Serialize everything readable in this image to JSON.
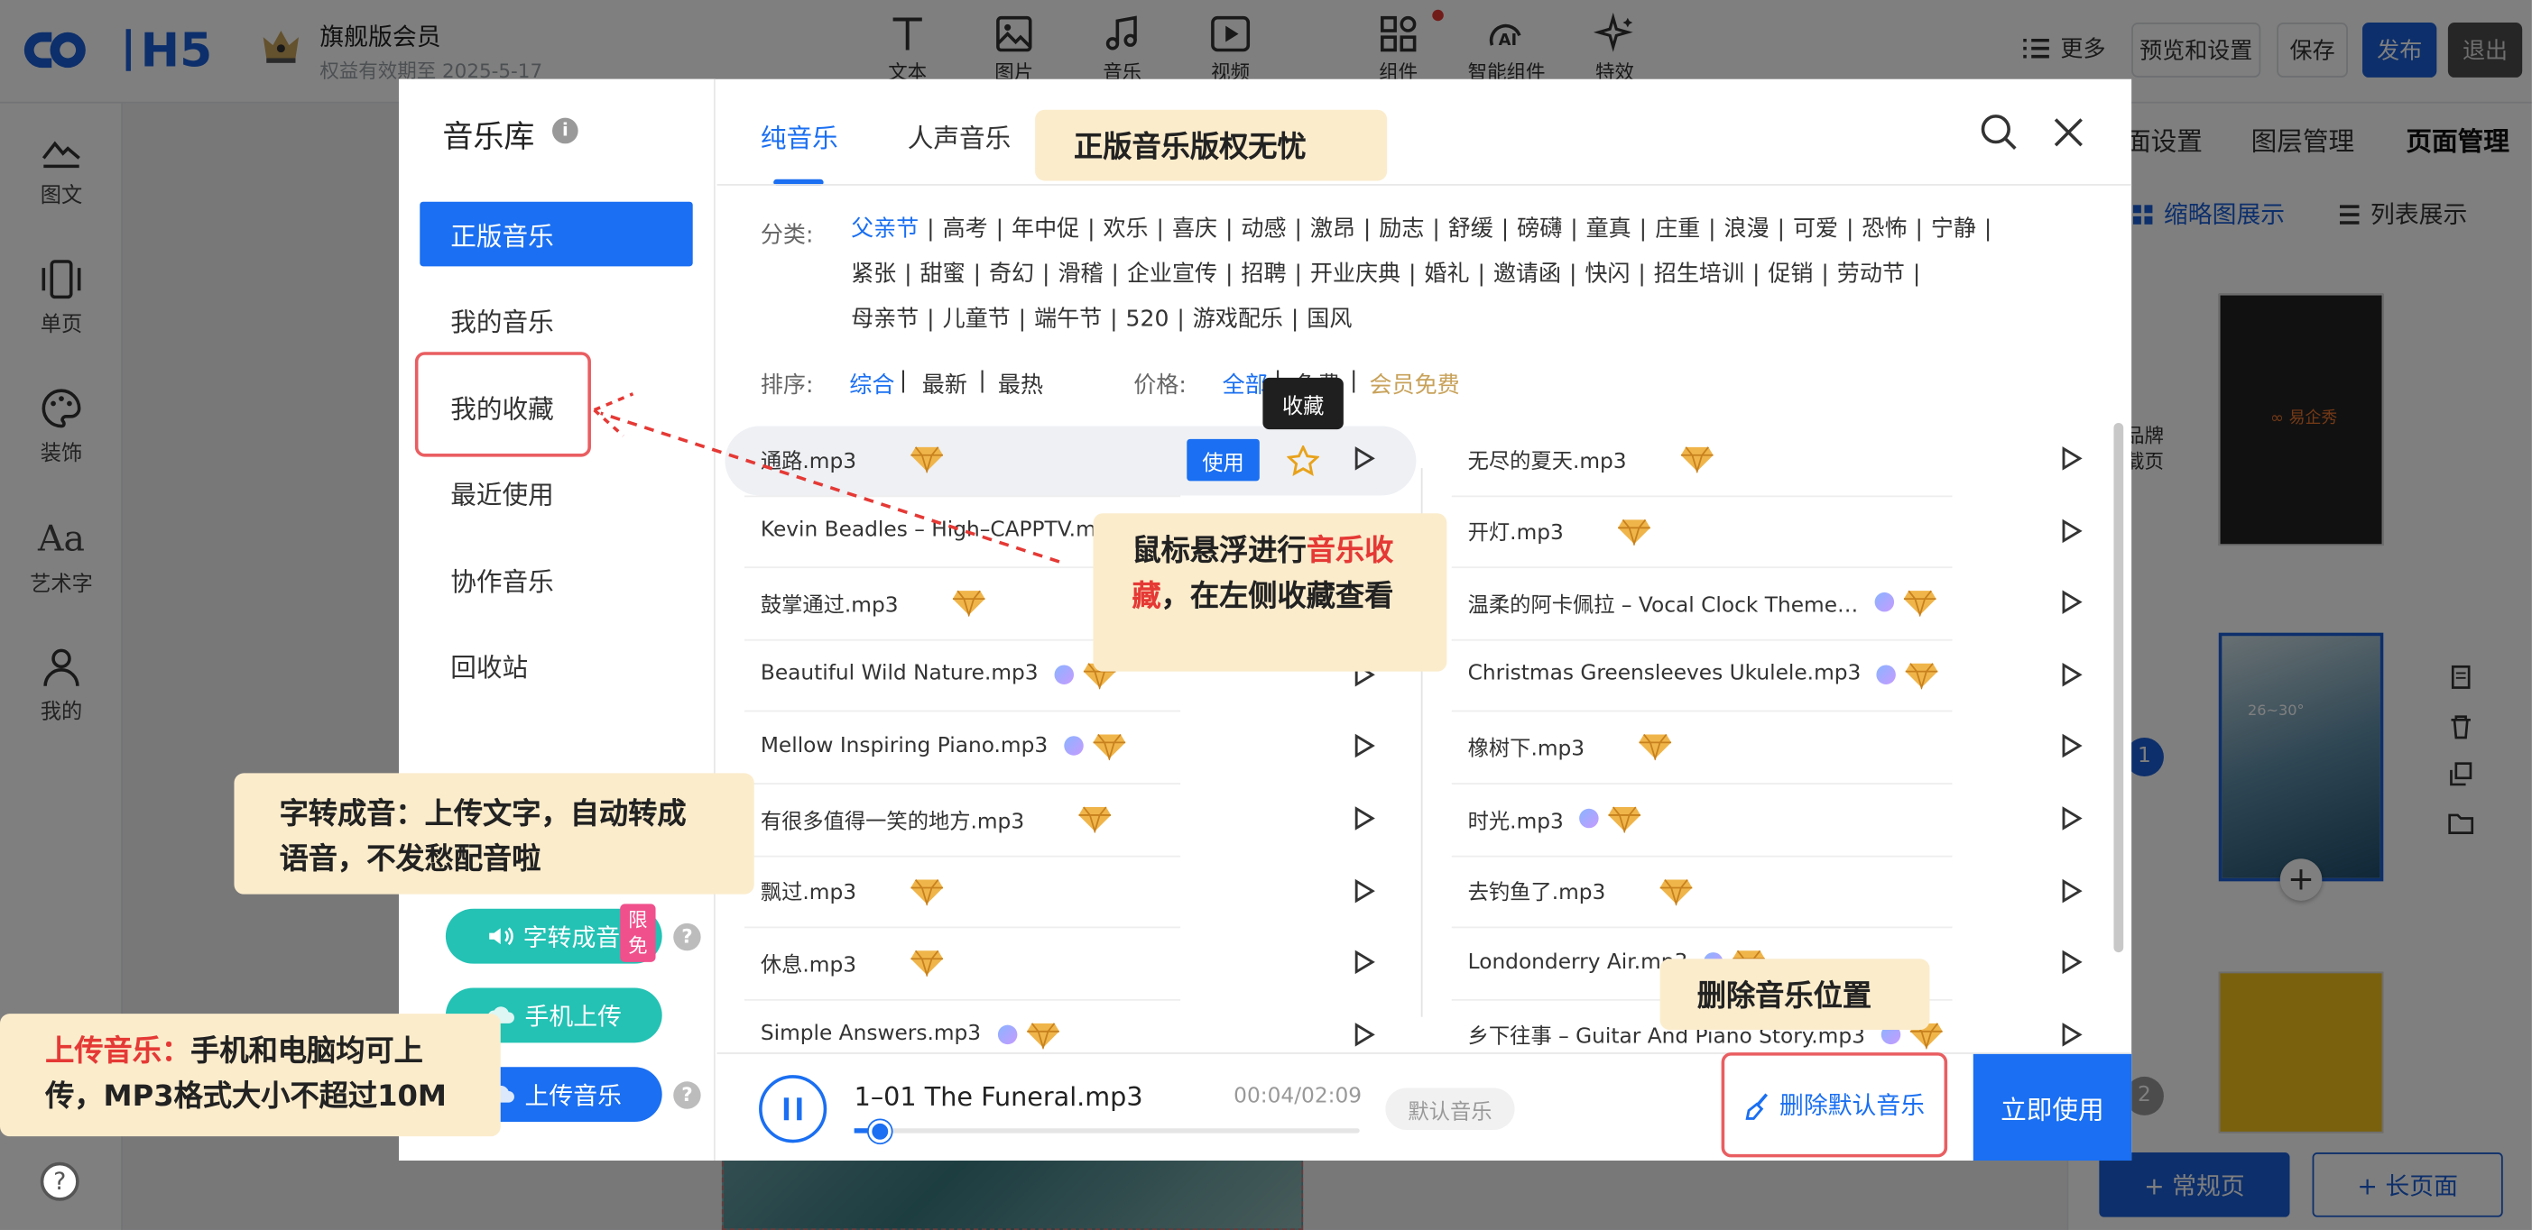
{
  "header": {
    "logo_text": "H5",
    "member_title": "旗舰版会员",
    "member_expiry": "权益有效期至 2025-5-17",
    "tools": [
      "文本",
      "图片",
      "音乐",
      "视频",
      "组件",
      "智能组件",
      "特效"
    ],
    "more_label": "更多",
    "preview_label": "预览和设置",
    "save_label": "保存",
    "publish_label": "发布",
    "exit_label": "退出"
  },
  "left_rail": [
    "图文",
    "单页",
    "装饰",
    "艺术字",
    "我的"
  ],
  "right_panel": {
    "tabs": [
      "面设置",
      "图层管理",
      "页面管理"
    ],
    "view_thumb": "缩略图展示",
    "view_list": "列表展示",
    "brand_label_1": "品牌",
    "brand_label_2": "载页",
    "page_number": "1",
    "page_number_2": "2",
    "add_normal": "+ 常规页",
    "add_long": "+ 长页面",
    "weather_text": "26~30°"
  },
  "library": {
    "title": "音乐库",
    "side_items": [
      "正版音乐",
      "我的音乐",
      "我的收藏",
      "最近使用",
      "协作音乐",
      "回收站"
    ],
    "tts_label": "字转成音",
    "limit_badge": "限免",
    "mobile_upload_label": "手机上传",
    "upload_label": "上传音乐"
  },
  "tabs": [
    "纯音乐",
    "人声音乐"
  ],
  "filters": {
    "category_label": "分类:",
    "categories": [
      "父亲节",
      "高考",
      "年中促",
      "欢乐",
      "喜庆",
      "动感",
      "激昂",
      "励志",
      "舒缓",
      "磅礴",
      "童真",
      "庄重",
      "浪漫",
      "可爱",
      "恐怖",
      "宁静",
      "紧张",
      "甜蜜",
      "奇幻",
      "滑稽",
      "企业宣传",
      "招聘",
      "开业庆典",
      "婚礼",
      "邀请函",
      "快闪",
      "招生培训",
      "促销",
      "劳动节",
      "母亲节",
      "儿童节",
      "端午节",
      "520",
      "游戏配乐",
      "国风"
    ],
    "sort_label": "排序:",
    "sort_options": [
      "综合",
      "最新",
      "最热"
    ],
    "price_label": "价格:",
    "price_options": [
      "全部",
      "免费",
      "会员免费"
    ]
  },
  "songs_left": [
    {
      "name": "通路.mp3",
      "badge": "gem"
    },
    {
      "name": "Kevin Beadles – High–CAPPTV.mp3",
      "badge": "gem"
    },
    {
      "name": "鼓掌通过.mp3",
      "badge": "gem"
    },
    {
      "name": "Beautiful Wild Nature.mp3",
      "badge": "pro+gem"
    },
    {
      "name": "Mellow Inspiring Piano.mp3",
      "badge": "pro+gem"
    },
    {
      "name": "有很多值得一笑的地方.mp3",
      "badge": "gem"
    },
    {
      "name": "飘过.mp3",
      "badge": "gem"
    },
    {
      "name": "休息.mp3",
      "badge": "gem"
    },
    {
      "name": "Simple Answers.mp3",
      "badge": "pro+gem"
    }
  ],
  "songs_right": [
    {
      "name": "无尽的夏天.mp3",
      "badge": "gem"
    },
    {
      "name": "开灯.mp3",
      "badge": "gem"
    },
    {
      "name": "温柔的阿卡佩拉 – Vocal Clock Theme…",
      "badge": "pro+gem"
    },
    {
      "name": "Christmas Greensleeves Ukulele.mp3",
      "badge": "pro+gem"
    },
    {
      "name": "橡树下.mp3",
      "badge": "gem"
    },
    {
      "name": "时光.mp3",
      "badge": "pro+gem"
    },
    {
      "name": "去钓鱼了.mp3",
      "badge": "gem"
    },
    {
      "name": "Londonderry Air.mp3",
      "badge": "pro+gem"
    },
    {
      "name": "乡下往事 – Guitar And Piano Story.mp3",
      "badge": "pro+gem"
    }
  ],
  "hover": {
    "use_label": "使用",
    "fav_tooltip": "收藏"
  },
  "player": {
    "track": "1–01 The Funeral.mp3",
    "time": "00:04/02:09",
    "progress": 0.03,
    "default_label": "默认音乐",
    "delete_default_label": "删除默认音乐",
    "use_now_label": "立即使用"
  },
  "callouts": {
    "licensed": "正版音乐版权无忧",
    "hover_part1": "鼠标悬浮进行",
    "hover_red": "音乐收藏",
    "hover_part2": "，在左侧收藏查看",
    "tts": "字转成音：上传文字，自动转成语音，不发愁配音啦",
    "upload_red": "上传音乐：",
    "upload_rest": "手机和电脑均可上传，MP3格式大小不超过10M",
    "delete_pos": "删除音乐位置"
  },
  "colors": {
    "primary": "#1a6ff2",
    "teal": "#23c2b4",
    "callout_bg": "#fbeccc",
    "highlight_red": "#e53935"
  }
}
